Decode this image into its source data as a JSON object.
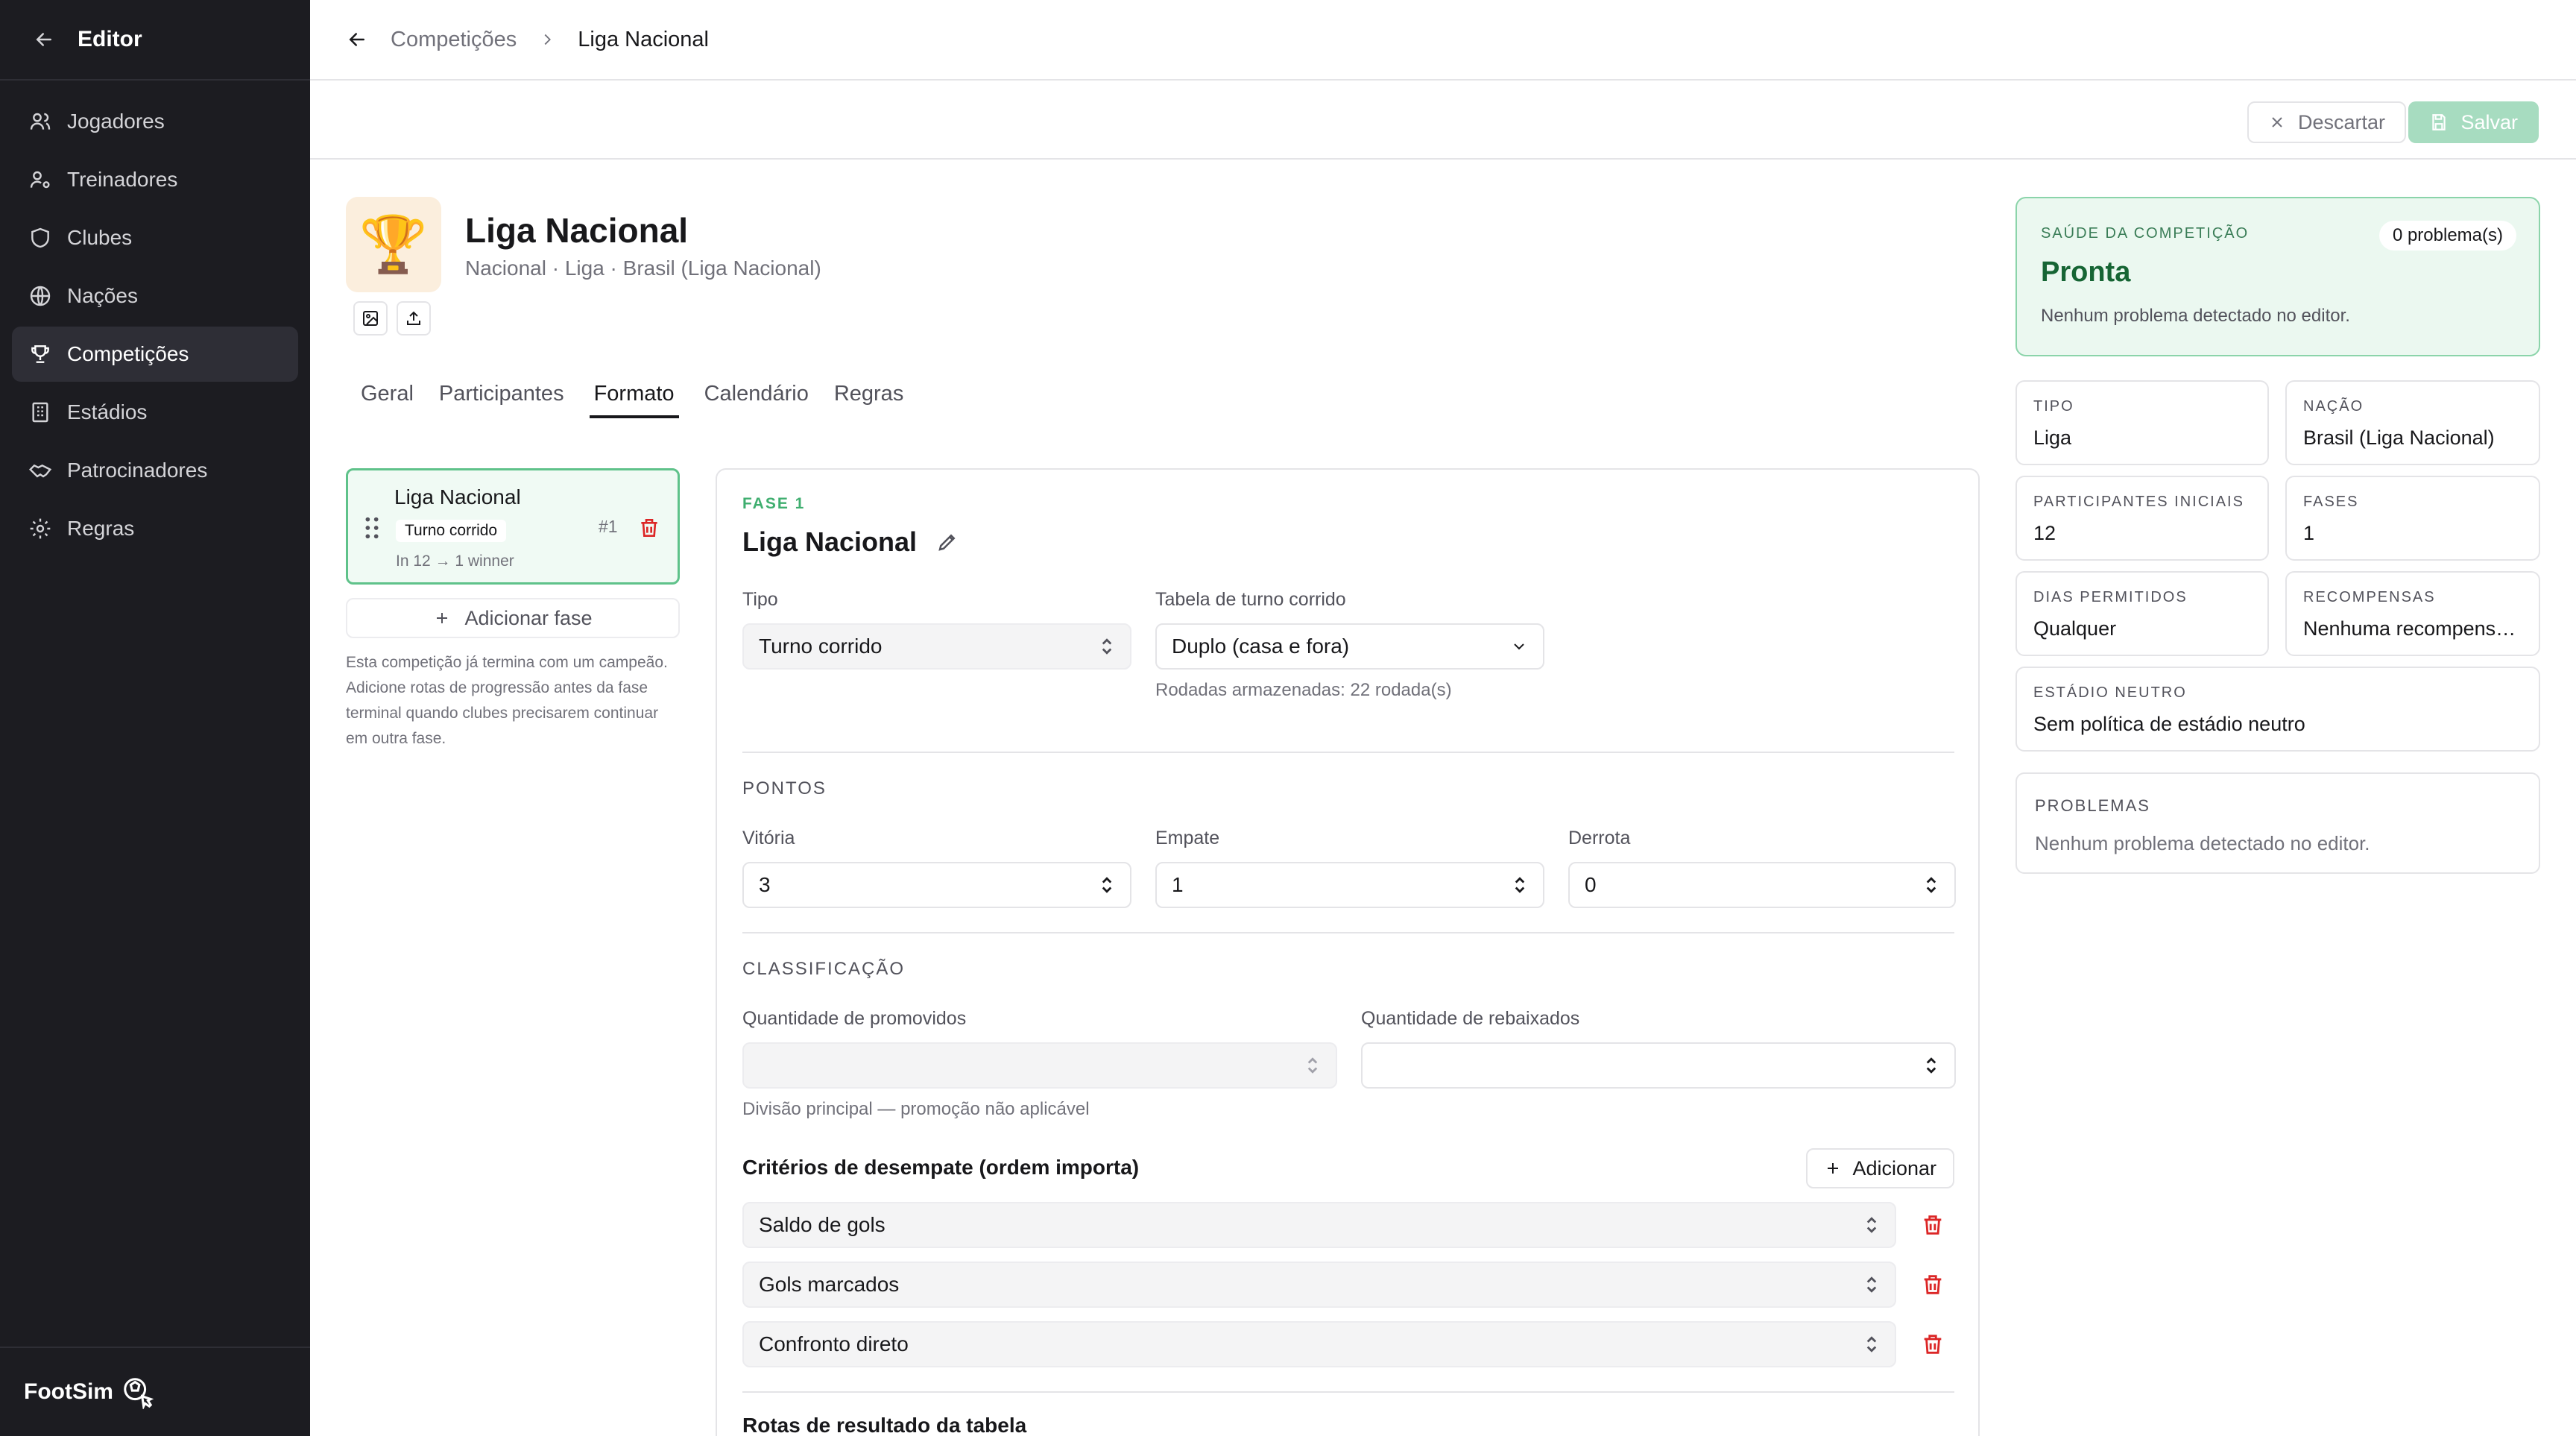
{
  "sidebar": {
    "title": "Editor",
    "items": [
      {
        "label": "Jogadores",
        "icon": "users-icon"
      },
      {
        "label": "Treinadores",
        "icon": "user-cog-icon"
      },
      {
        "label": "Clubes",
        "icon": "shield-icon"
      },
      {
        "label": "Nações",
        "icon": "globe-icon"
      },
      {
        "label": "Competições",
        "icon": "trophy-icon",
        "active": true
      },
      {
        "label": "Estádios",
        "icon": "building-icon"
      },
      {
        "label": "Patrocinadores",
        "icon": "handshake-icon"
      },
      {
        "label": "Regras",
        "icon": "gear-icon"
      }
    ],
    "brand": "FootSim"
  },
  "breadcrumb": {
    "parent": "Competições",
    "current": "Liga Nacional"
  },
  "toolbar": {
    "discard_label": "Descartar",
    "save_label": "Salvar"
  },
  "competition": {
    "emblem": "🏆",
    "title": "Liga Nacional",
    "subtitle": "Nacional · Liga · Brasil (Liga Nacional)"
  },
  "tabs": [
    "Geral",
    "Participantes",
    "Formato",
    "Calendário",
    "Regras"
  ],
  "active_tab": "Formato",
  "phase_card": {
    "title": "Liga Nacional",
    "badge": "Turno corrido",
    "number": "#1",
    "meta": "In 12 → 1 winner"
  },
  "add_phase_label": "Adicionar fase",
  "note": "Esta competição já termina com um campeão. Adicione rotas de progressão antes da fase terminal quando clubes precisarem continuar em outra fase.",
  "form": {
    "phase_label": "FASE 1",
    "phase_name": "Liga Nacional",
    "type_label": "Tipo",
    "type_value": "Turno corrido",
    "table_label": "Tabela de turno corrido",
    "table_value": "Duplo (casa e fora)",
    "rounds_hint": "Rodadas armazenadas: 22 rodada(s)",
    "points_section": "PONTOS",
    "win_label": "Vitória",
    "win_value": "3",
    "draw_label": "Empate",
    "draw_value": "1",
    "loss_label": "Derrota",
    "loss_value": "0",
    "classification_section": "CLASSIFICAÇÃO",
    "promoted_label": "Quantidade de promovidos",
    "promoted_value": "",
    "relegated_label": "Quantidade de rebaixados",
    "relegated_value": "",
    "promoted_hint": "Divisão principal — promoção não aplicável",
    "tiebreak_title": "Critérios de desempate (ordem importa)",
    "add_label": "Adicionar",
    "tiebreaks": [
      "Saldo de gols",
      "Gols marcados",
      "Confronto direto"
    ],
    "routes_title": "Rotas de resultado da tabela"
  },
  "health": {
    "label": "SAÚDE DA COMPETIÇÃO",
    "badge": "0 problema(s)",
    "status": "Pronta",
    "description": "Nenhum problema detectado no editor."
  },
  "stats": [
    {
      "key": "TIPO",
      "value": "Liga"
    },
    {
      "key": "NAÇÃO",
      "value": "Brasil (Liga Nacional)"
    },
    {
      "key": "PARTICIPANTES INICIAIS",
      "value": "12"
    },
    {
      "key": "FASES",
      "value": "1"
    },
    {
      "key": "DIAS PERMITIDOS",
      "value": "Qualquer"
    },
    {
      "key": "RECOMPENSAS",
      "value": "Nenhuma recompensa..."
    },
    {
      "key": "ESTÁDIO NEUTRO",
      "value": "Sem política de estádio neutro"
    }
  ],
  "problems": {
    "label": "PROBLEMAS",
    "value": "Nenhum problema detectado no editor."
  },
  "colors": {
    "accent": "#3fae6f",
    "sidebar_bg": "#1c1c21",
    "danger": "#dc2626",
    "health_bg": "#ebf8f0"
  }
}
